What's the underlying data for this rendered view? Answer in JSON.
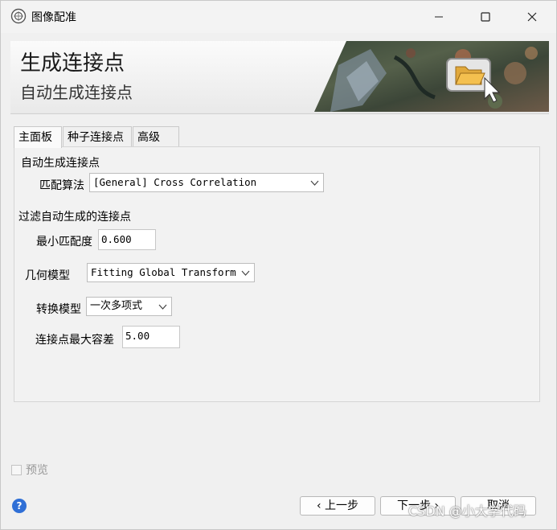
{
  "window": {
    "title": "图像配准"
  },
  "banner": {
    "title": "生成连接点",
    "subtitle": "自动生成连接点"
  },
  "tabs": [
    {
      "label": "主面板",
      "active": true
    },
    {
      "label": "种子连接点",
      "active": false
    },
    {
      "label": "高级",
      "active": false
    }
  ],
  "auto_group": {
    "title": "自动生成连接点",
    "algorithm_label": "匹配算法",
    "algorithm_value": "[General] Cross Correlation"
  },
  "filter_group": {
    "title": "过滤自动生成的连接点",
    "min_match_label": "最小匹配度",
    "min_match_value": "0.600",
    "geometric_label": "几何模型",
    "geometric_value": "Fitting Global Transform",
    "transform_label": "转换模型",
    "transform_value": "一次多项式",
    "max_tolerance_label": "连接点最大容差",
    "max_tolerance_value": "5.00"
  },
  "preview": {
    "label": "预览",
    "checked": false
  },
  "buttons": {
    "prev": "‹ 上一步",
    "next": "下一步 ›",
    "cancel": "取消"
  },
  "watermark": "CSDN @小大学代码",
  "colors": {
    "help_icon": "#2f6fd6",
    "window_bg": "#f0f0f0"
  }
}
